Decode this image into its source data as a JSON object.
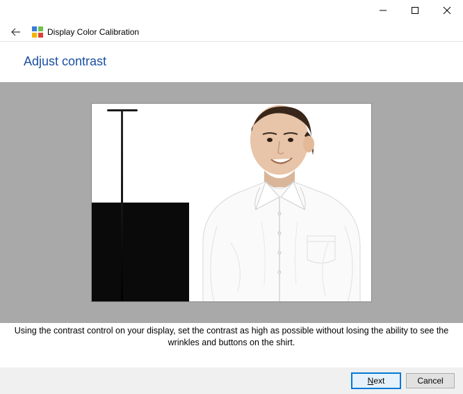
{
  "window": {
    "title": "Display Color Calibration",
    "controls": {
      "minimize": "minimize",
      "maximize": "maximize",
      "close": "close"
    }
  },
  "header": {
    "back": "back"
  },
  "page": {
    "heading": "Adjust contrast",
    "instruction": "Using the contrast control on your display, set the contrast as high as possible without losing the ability to see the wrinkles and buttons on the shirt."
  },
  "footer": {
    "next_prefix": "N",
    "next_rest": "ext",
    "cancel": "Cancel"
  }
}
